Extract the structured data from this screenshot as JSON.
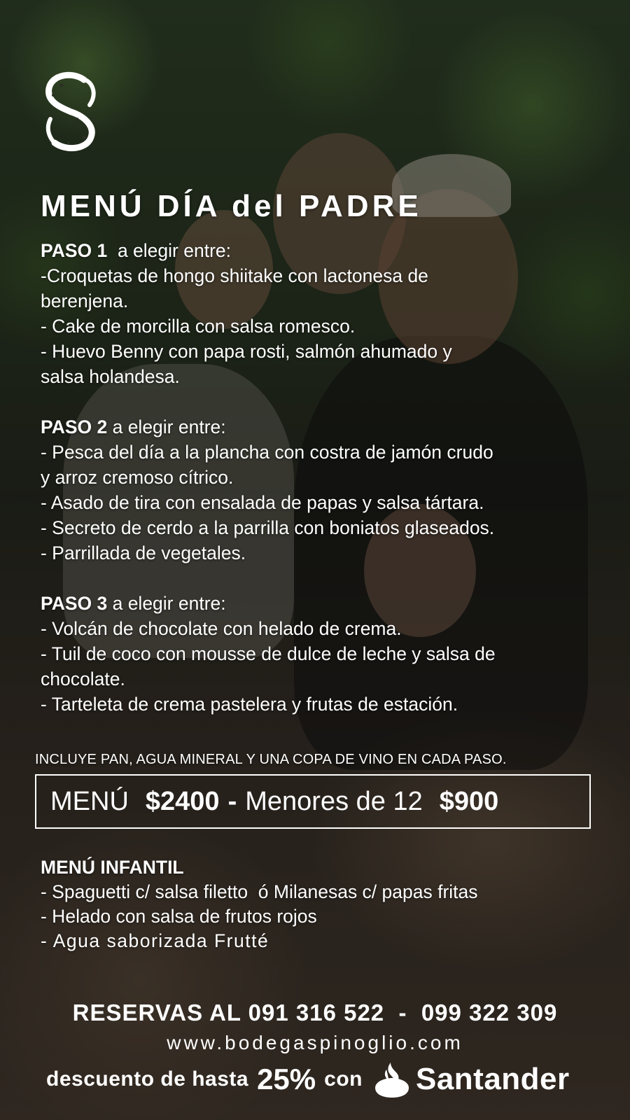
{
  "title": "MENÚ DÍA del PADRE",
  "paso1": {
    "label": "PASO 1",
    "suffix": "  a elegir entre:",
    "lines": [
      "-Croquetas de hongo shiitake con lactonesa de",
      "berenjena.",
      "- Cake de morcilla con salsa romesco.",
      "- Huevo Benny con papa rosti, salmón ahumado y",
      "salsa holandesa."
    ]
  },
  "paso2": {
    "label": "PASO 2",
    "suffix": " a elegir entre:",
    "lines": [
      "- Pesca del día a la plancha con costra de jamón crudo",
      "y arroz cremoso cítrico.",
      "- Asado de tira con ensalada de papas y salsa tártara.",
      "- Secreto de cerdo a la parrilla con boniatos glaseados.",
      "- Parrillada de vegetales."
    ]
  },
  "paso3": {
    "label": "PASO 3",
    "suffix": " a elegir entre:",
    "lines": [
      "- Volcán de chocolate con helado de crema.",
      "- Tuil de coco con mousse de dulce de leche y salsa de",
      "chocolate.",
      "- Tarteleta de crema pastelera y frutas de estación."
    ]
  },
  "includes": "INCLUYE PAN, AGUA MINERAL Y UNA COPA DE VINO EN CADA PASO.",
  "price": {
    "menu_label": "MENÚ",
    "menu_price": "$2400",
    "separator": "-",
    "minors_label": "Menores de 12",
    "minors_price": "$900"
  },
  "kids_menu": {
    "title": "MENÚ INFANTIL",
    "lines": [
      "- Spaguetti c/ salsa filetto  ó Milanesas c/ papas fritas",
      "- Helado con salsa de frutos rojos",
      "- Agua saborizada Frutté"
    ]
  },
  "reservas": "RESERVAS AL 091 316 522  -  099 322 309",
  "website": "www.bodegaspinoglio.com",
  "promo": {
    "text1": "descuento de hasta",
    "percent": "25%",
    "text2": "con",
    "brand": "Santander"
  },
  "colors": {
    "text": "#ffffff",
    "foliage": "#32472a",
    "overlay": "rgba(10,10,10,0.42)"
  },
  "icons": {
    "logo": "spinoglio-s-logo-icon",
    "brand": "santander-flame-icon"
  }
}
